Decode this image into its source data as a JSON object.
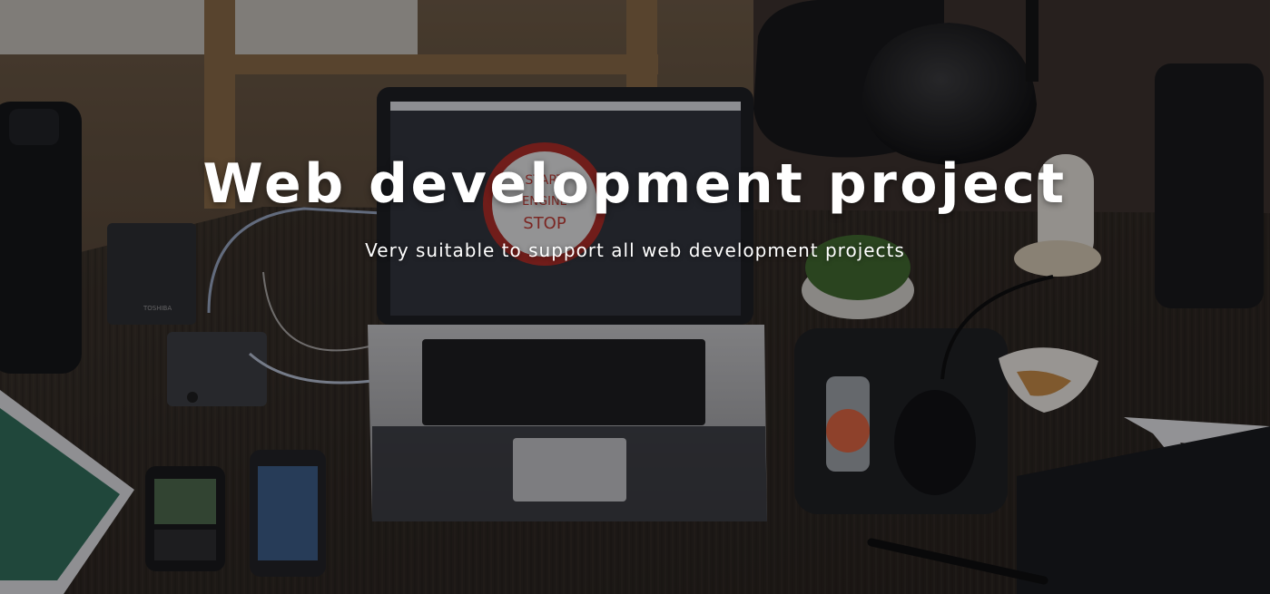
{
  "hero": {
    "title": "Web development project",
    "subtitle": "Very suitable to support all web development projects",
    "background_image": "desk-workspace-photo",
    "overlay_color": "#08080a"
  },
  "laptop_screen": {
    "sign_line1": "START",
    "sign_line2": "ENGINE",
    "sign_line3": "STOP"
  },
  "scene_labels": {
    "hard_drive_brand": "TOSHIBA"
  }
}
